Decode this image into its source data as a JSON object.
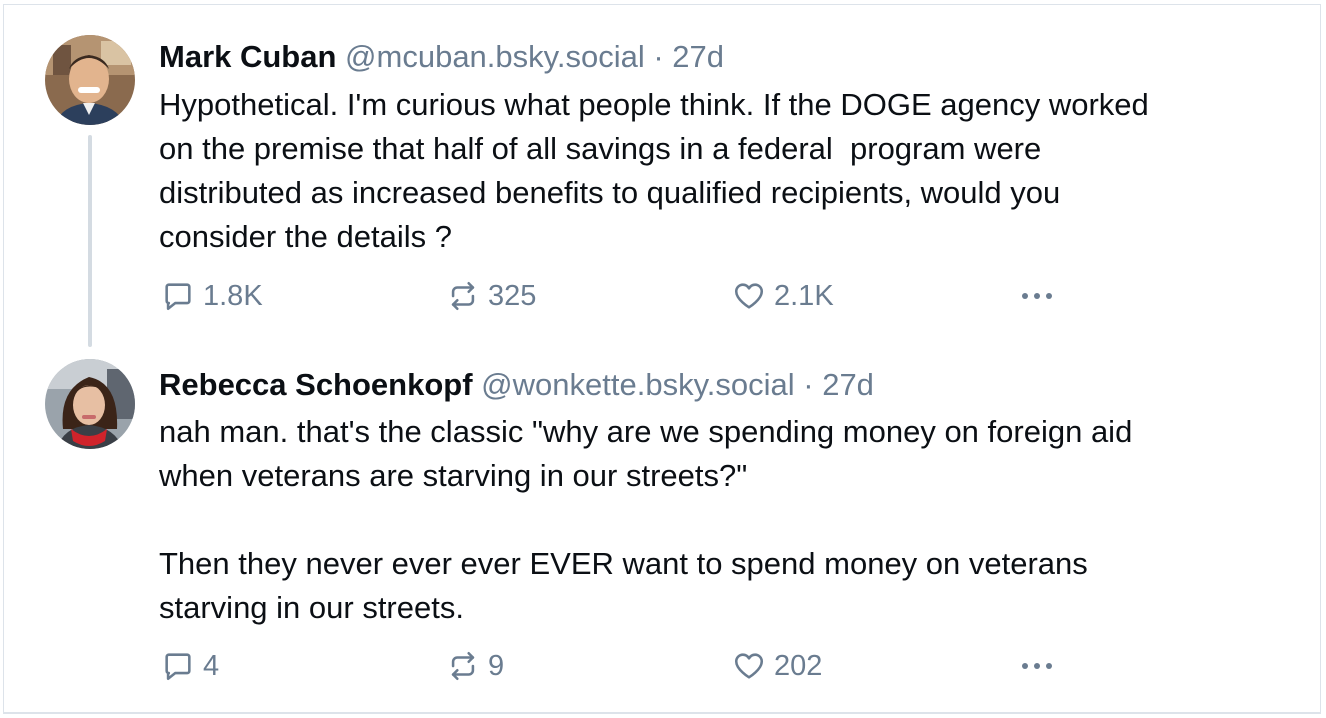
{
  "posts": [
    {
      "author": {
        "display_name": "Mark Cuban",
        "handle": "@mcuban.bsky.social",
        "avatar_icon": "avatar-photo-man"
      },
      "separator": " · ",
      "time_ago": "27d",
      "text": "Hypothetical. I'm curious what people think. If the DOGE agency worked\non the premise that half of all savings in a federal  program were\ndistributed as increased benefits to qualified recipients, would you\nconsider the details ?",
      "stats": {
        "replies": "1.8K",
        "reposts": "325",
        "likes": "2.1K"
      }
    },
    {
      "author": {
        "display_name": "Rebecca Schoenkopf",
        "handle": "@wonkette.bsky.social",
        "avatar_icon": "avatar-photo-woman"
      },
      "separator": " · ",
      "time_ago": "27d",
      "text": "nah man. that's the classic \"why are we spending money on foreign aid\nwhen veterans are starving in our streets?\"\n\nThen they never ever ever EVER want to spend money on veterans\nstarving in our streets.",
      "stats": {
        "replies": "4",
        "reposts": "9",
        "likes": "202"
      }
    }
  ],
  "icons": {
    "reply": "reply-bubble-icon",
    "repost": "repost-arrows-icon",
    "like": "heart-icon",
    "more": "more-options-icon"
  },
  "colors": {
    "text": "#0b0f14",
    "muted": "#6a7c90",
    "thread_line": "#d4dbe2",
    "border": "#dde3ea"
  }
}
